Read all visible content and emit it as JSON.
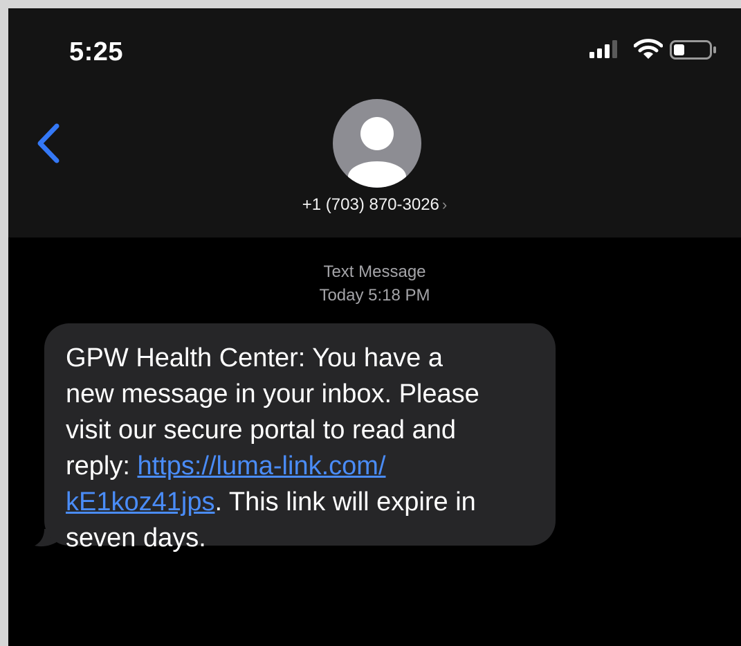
{
  "status_bar": {
    "time": "5:25",
    "signal_icon": "cellular-signal-icon",
    "wifi_icon": "wifi-icon",
    "battery_icon": "battery-icon",
    "battery_level": 0.3
  },
  "header": {
    "back_icon": "chevron-left-icon",
    "avatar_icon": "person-silhouette-icon",
    "contact_number": "+1 (703) 870-3026",
    "contact_chevron": "›"
  },
  "thread": {
    "service_label": "Text Message",
    "timestamp": "Today 5:18 PM"
  },
  "message": {
    "line1": "GPW Health Center: You have a",
    "line2": "new message in your inbox. Please",
    "line3": "visit our secure portal to read and",
    "line4_prefix": "reply: ",
    "link_part1": "https://luma-link.com/",
    "link_part2": "kE1koz41jps",
    "line5_suffix": ". This link will expire in",
    "line6": "seven days."
  },
  "colors": {
    "accent_blue": "#3478f6",
    "link_blue": "#4a8cf7",
    "bubble_gray": "#262628",
    "header_bg": "#141414",
    "screen_bg": "#000000"
  }
}
